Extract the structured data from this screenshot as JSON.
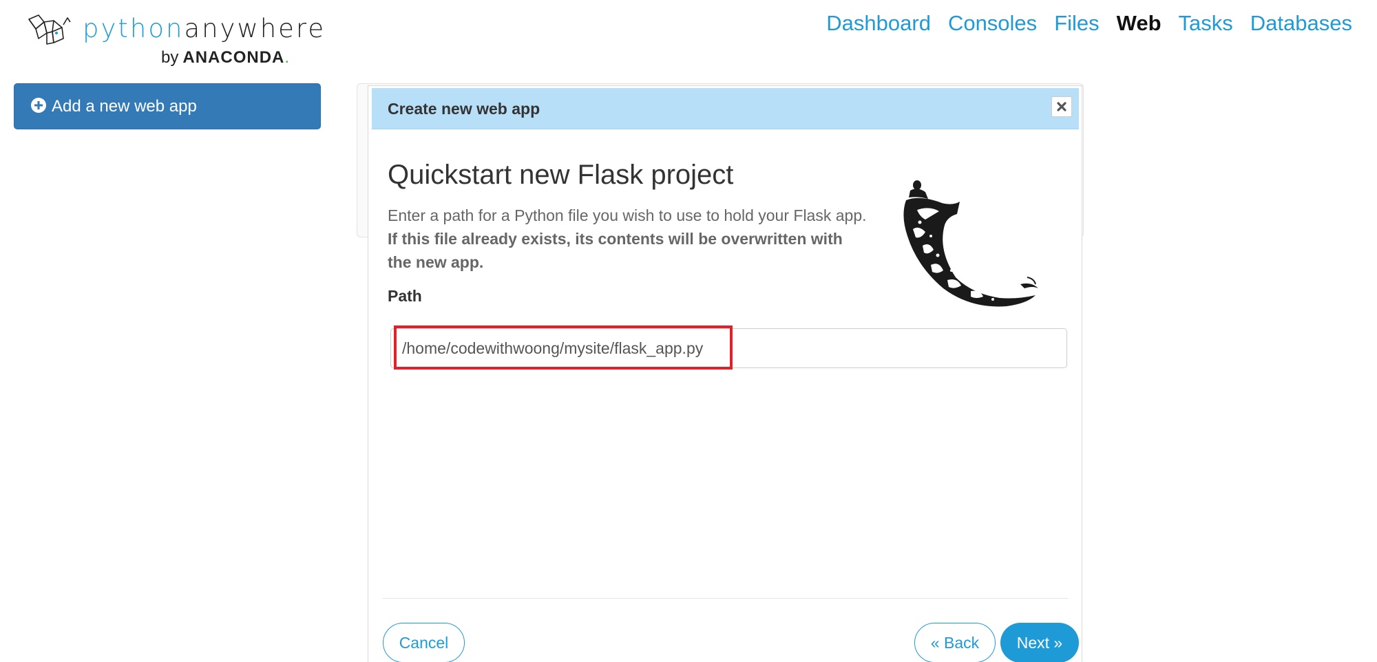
{
  "header": {
    "logo": {
      "word_python": "python",
      "word_anywhere": "anywhere",
      "by": "by",
      "brand": "ANACONDA",
      "brand_dot": "."
    },
    "nav": [
      {
        "label": "Dashboard",
        "active": false
      },
      {
        "label": "Consoles",
        "active": false
      },
      {
        "label": "Files",
        "active": false
      },
      {
        "label": "Web",
        "active": true
      },
      {
        "label": "Tasks",
        "active": false
      },
      {
        "label": "Databases",
        "active": false
      }
    ]
  },
  "sidebar": {
    "add_button_label": "Add a new web app",
    "add_button_icon": "plus-circle-icon"
  },
  "modal": {
    "title": "Create new web app",
    "close_icon": "close-icon",
    "heading": "Quickstart new Flask project",
    "description_plain": "Enter a path for a Python file you wish to use to hold your Flask app.",
    "description_bold": "If this file already exists, its contents will be overwritten with the new app.",
    "path_label": "Path",
    "path_value": "/home/codewithwoong/mysite/flask_app.py",
    "buttons": {
      "cancel": "Cancel",
      "back": "« Back",
      "next": "Next »"
    }
  },
  "colors": {
    "accent": "#1e9bd7",
    "primary_button": "#337ab7",
    "modal_header": "#b7dff8",
    "highlight": "#e0202a"
  }
}
